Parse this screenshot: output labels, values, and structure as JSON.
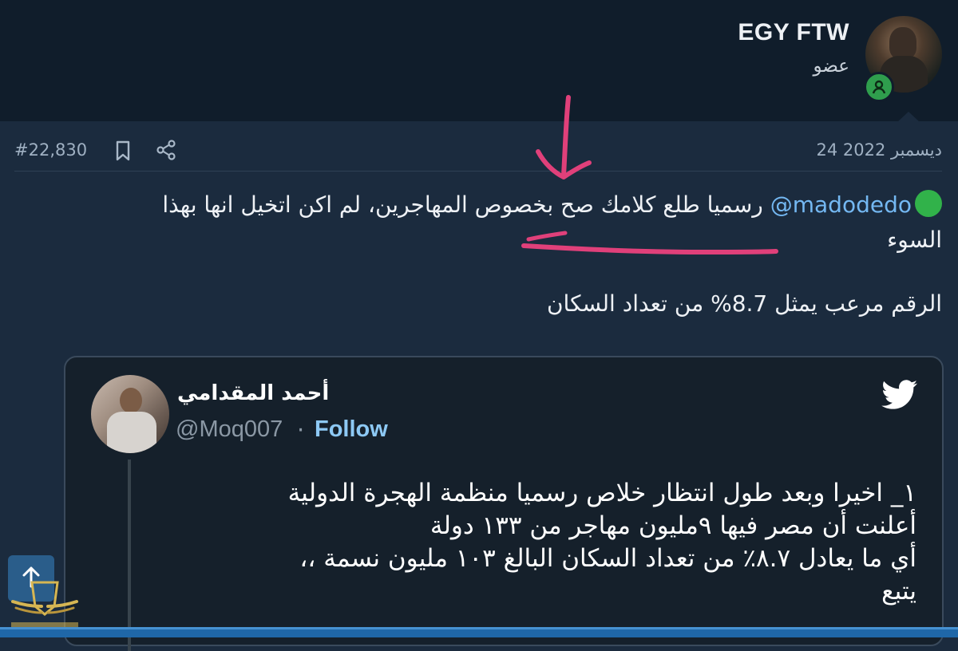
{
  "header": {
    "username": "EGY FTW",
    "role": "عضو"
  },
  "post": {
    "number": "#22,830",
    "date": "24 ديسمبر 2022",
    "mention": "madodedo@",
    "line1": "رسميا طلع كلامك صح بخصوص المهاجرين، لم اكن اتخيل انها بهذا",
    "line2": "السوء",
    "line3": "الرقم مرعب يمثل 8.7% من تعداد السكان"
  },
  "tweet": {
    "author": "أحمد المقدامي",
    "handle": "@Moq007",
    "separator": "·",
    "follow_label": "Follow",
    "lines": [
      "١_ اخيرا وبعد طول انتظار خلاص رسميا منظمة الهجرة الدولية",
      "أعلنت أن مصر فيها ٩مليون مهاجر من ١٣٣ دولة",
      "أي ما يعادل ٨.٧٪ من تعداد السكان البالغ ١٠٣ مليون نسمة ،،",
      "يتبع"
    ]
  },
  "colors": {
    "page_bg": "#1b2b3e",
    "header_bg": "#101d2b",
    "mention": "#74b8f2",
    "follow": "#8dc9f5",
    "annotation": "#e0407a",
    "online": "#2f9e4d"
  },
  "icons": [
    "bookmark-icon",
    "share-icon",
    "twitter-bird-icon",
    "scroll-top-icon",
    "online-status-icon"
  ]
}
